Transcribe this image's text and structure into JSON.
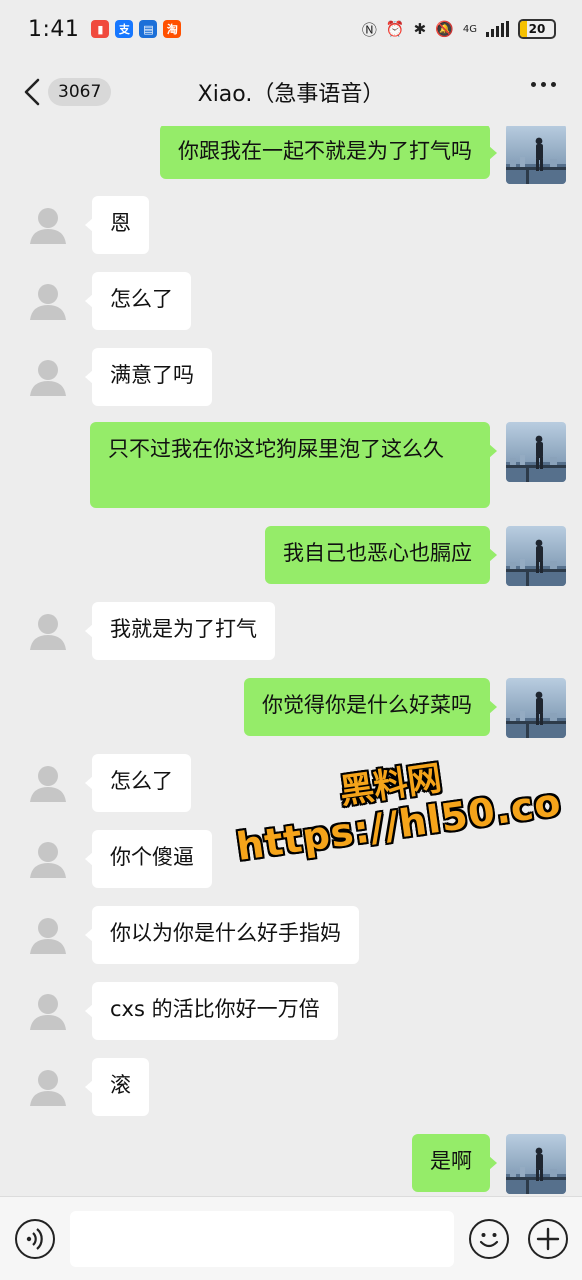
{
  "status_bar": {
    "time": "1:41",
    "battery": "20",
    "network": "4G",
    "app_icons": [
      {
        "name": "app-icon-red",
        "color": "#f04a3e",
        "glyph": "▮"
      },
      {
        "name": "alipay-icon",
        "color": "#1677ff",
        "glyph": "支"
      },
      {
        "name": "bank-app-icon",
        "color": "#1b6fd8",
        "glyph": "▤"
      },
      {
        "name": "taobao-icon",
        "color": "#ff5000",
        "glyph": "淘"
      }
    ]
  },
  "header": {
    "unread_count": "3067",
    "title": "Xiao.（急事语音）"
  },
  "messages": [
    {
      "side": "self",
      "text": "你跟我在一起不就是为了打气吗"
    },
    {
      "side": "other",
      "text": "恩"
    },
    {
      "side": "other",
      "text": "怎么了"
    },
    {
      "side": "other",
      "text": "满意了吗"
    },
    {
      "side": "self",
      "text": "只不过我在你这坨狗屎里泡了这么久"
    },
    {
      "side": "self",
      "text": "我自己也恶心也膈应"
    },
    {
      "side": "other",
      "text": "我就是为了打气"
    },
    {
      "side": "self",
      "text": "你觉得你是什么好菜吗"
    },
    {
      "side": "other",
      "text": "怎么了"
    },
    {
      "side": "other",
      "text": "你个傻逼"
    },
    {
      "side": "other",
      "text": "你以为你是什么好手指妈"
    },
    {
      "side": "other",
      "text": "cxs 的活比你好一万倍"
    },
    {
      "side": "other",
      "text": "滚"
    },
    {
      "side": "self",
      "text": "是啊"
    }
  ],
  "watermark": {
    "line1": "黑料网",
    "line2": "https://hl50.co"
  },
  "input_bar": {
    "placeholder": ""
  },
  "colors": {
    "background": "#ededed",
    "self_bubble": "#95ec69",
    "other_bubble": "#ffffff",
    "watermark": "#f5a41a"
  }
}
